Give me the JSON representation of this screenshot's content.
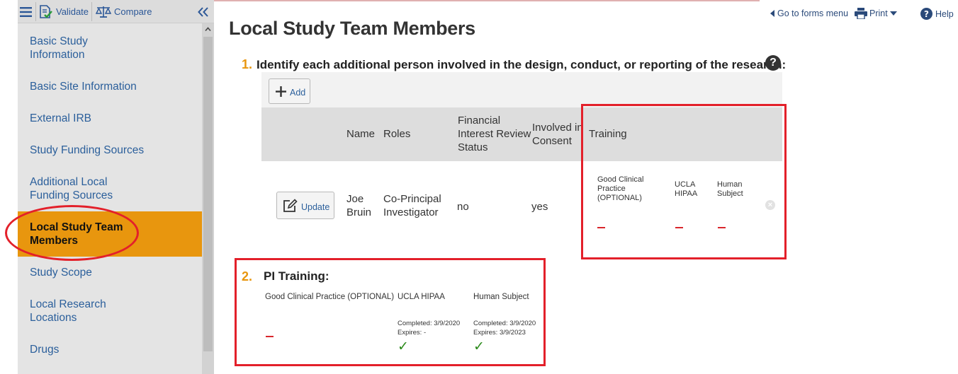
{
  "toolbar": {
    "validate_label": "Validate",
    "compare_label": "Compare"
  },
  "sidebar": {
    "items": [
      {
        "label_l1": "Basic Study",
        "label_l2": "Information"
      },
      {
        "label_l1": "Basic Site Information",
        "label_l2": ""
      },
      {
        "label_l1": "External IRB",
        "label_l2": ""
      },
      {
        "label_l1": "Study Funding Sources",
        "label_l2": ""
      },
      {
        "label_l1": "Additional Local",
        "label_l2": "Funding Sources"
      },
      {
        "label_l1": "Local Study Team",
        "label_l2": "Members"
      },
      {
        "label_l1": "Study Scope",
        "label_l2": ""
      },
      {
        "label_l1": "Local Research",
        "label_l2": "Locations"
      },
      {
        "label_l1": "Drugs",
        "label_l2": ""
      }
    ],
    "active_index": 5,
    "active_color": "#e8960e"
  },
  "header": {
    "forms_menu_label": "Go to forms menu",
    "print_label": "Print",
    "help_label": "Help"
  },
  "page": {
    "title": "Local Study Team Members"
  },
  "question1": {
    "number": "1.",
    "text": "Identify each additional person involved in the design, conduct, or reporting of the research:",
    "help_glyph": "?",
    "add_label": "Add",
    "columns": {
      "name": "Name",
      "roles": "Roles",
      "financial_l1": "Financial",
      "financial_l2": "Interest Review",
      "financial_l3": "Status",
      "consent_l1": "Involved in",
      "consent_l2": "Consent",
      "training": "Training"
    },
    "row": {
      "update_label": "Update",
      "name_l1": "Joe",
      "name_l2": "Bruin",
      "role_l1": "Co-Principal",
      "role_l2": "Investigator",
      "financial": "no",
      "consent": "yes",
      "training": {
        "gcp_l1": "Good Clinical",
        "gcp_l2": "Practice",
        "gcp_l3": "(OPTIONAL)",
        "hipaa_l1": "UCLA",
        "hipaa_l2": "HIPAA",
        "human_l1": "Human",
        "human_l2": "Subject"
      }
    }
  },
  "question2": {
    "number": "2.",
    "text": "PI Training:",
    "gcp_label": "Good Clinical Practice (OPTIONAL)",
    "hipaa_label": "UCLA HIPAA",
    "human_label": "Human Subject",
    "hipaa_completed": "Completed: 3/9/2020",
    "hipaa_expires": "Expires: -",
    "human_completed": "Completed: 3/9/2020",
    "human_expires": "Expires: 3/9/2023",
    "check_glyph": "✓"
  },
  "colors": {
    "accent": "#e8960e",
    "annotation_red": "#e3202a",
    "link_blue": "#2b5f9b",
    "check_green": "#2a8a1a"
  }
}
